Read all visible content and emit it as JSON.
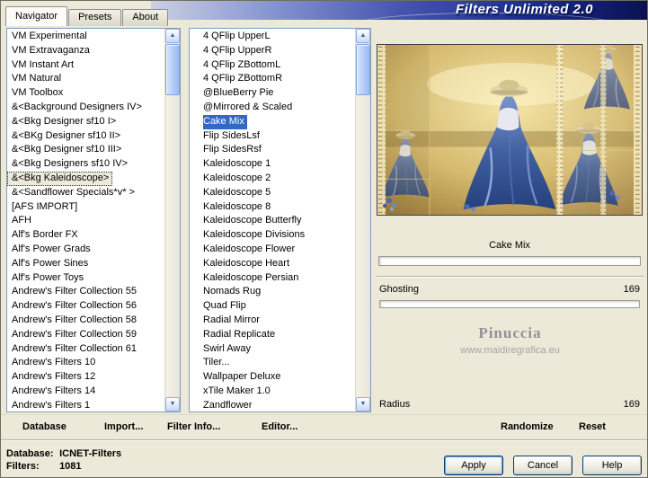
{
  "title": "Filters Unlimited 2.0",
  "tabs": {
    "navigator": "Navigator",
    "presets": "Presets",
    "about": "About"
  },
  "categories": {
    "selected": "&<Bkg Kaleidoscope>",
    "selected_class": "sel-focus",
    "items": [
      "VM Experimental",
      "VM Extravaganza",
      "VM Instant Art",
      "VM Natural",
      "VM Toolbox",
      "&<Background Designers IV>",
      "&<Bkg Designer sf10 I>",
      "&<BKg Designer sf10 II>",
      "&<Bkg Designer sf10 III>",
      "&<Bkg Designers sf10 IV>",
      "&<Bkg Kaleidoscope>",
      "&<Sandflower Specials*v* >",
      "[AFS IMPORT]",
      "AFH",
      "Alf's Border FX",
      "Alf's Power Grads",
      "Alf's Power Sines",
      "Alf's Power Toys",
      "Andrew's Filter Collection 55",
      "Andrew's Filter Collection 56",
      "Andrew's Filter Collection 58",
      "Andrew's Filter Collection 59",
      "Andrew's Filter Collection 61",
      "Andrew's Filters 10",
      "Andrew's Filters 12",
      "Andrew's Filters 14",
      "Andrew's Filters 1"
    ]
  },
  "filters_list": {
    "selected": "Cake Mix",
    "selected_class": "sel-blue",
    "items": [
      "4 QFlip UpperL",
      "4 QFlip UpperR",
      "4 QFlip ZBottomL",
      "4 QFlip ZBottomR",
      "@BlueBerry Pie",
      "@Mirrored & Scaled",
      "Cake Mix",
      "Flip SidesLsf",
      "Flip SidesRsf",
      "Kaleidoscope 1",
      "Kaleidoscope 2",
      "Kaleidoscope 5",
      "Kaleidoscope 8",
      "Kaleidoscope Butterfly",
      "Kaleidoscope Divisions",
      "Kaleidoscope Flower",
      "Kaleidoscope Heart",
      "Kaleidoscope Persian",
      "Nomads Rug",
      "Quad Flip",
      "Radial Mirror",
      "Radial Replicate",
      "Swirl Away",
      "Tiler...",
      "Wallpaper Deluxe",
      "xTile Maker 1.0",
      "Zandflower"
    ]
  },
  "preview": {
    "filter_name": "Cake Mix"
  },
  "sliders": {
    "ghosting": {
      "label": "Ghosting",
      "value": "169"
    },
    "radius": {
      "label": "Radius",
      "value": "169"
    }
  },
  "watermark": {
    "name": "Pinuccia",
    "url": "www.maidiregrafica.eu"
  },
  "toolbar": {
    "database": "Database",
    "import": "Import...",
    "filter_info": "Filter Info...",
    "editor": "Editor...",
    "randomize": "Randomize",
    "reset": "Reset"
  },
  "status": {
    "database_label": "Database:",
    "database_value": "ICNET-Filters",
    "filters_label": "Filters:",
    "filters_value": "1081"
  },
  "buttons": {
    "apply": "Apply",
    "cancel": "Cancel",
    "help": "Help"
  },
  "colors": {
    "selection": "#316ac5",
    "background": "#ece9d8",
    "banner_dark": "#0a1250"
  }
}
